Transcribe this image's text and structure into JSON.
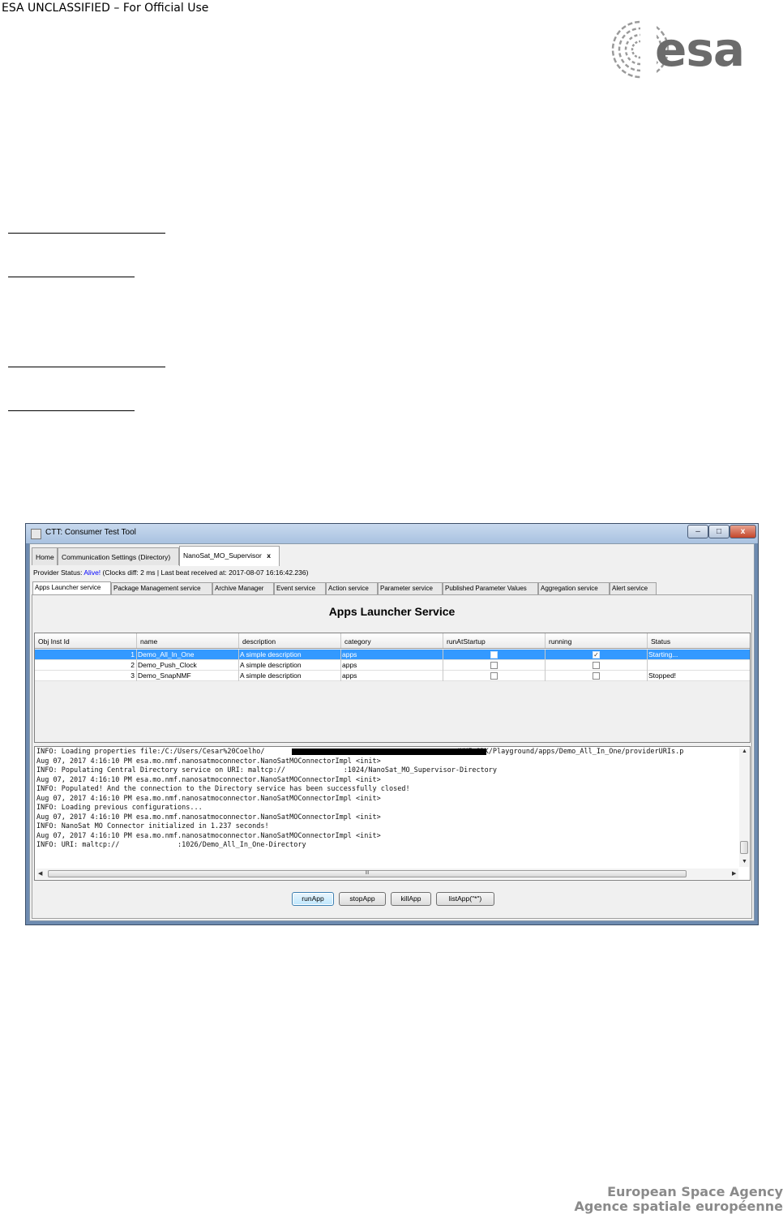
{
  "document": {
    "classification": "ESA UNCLASSIFIED – For Official Use",
    "logo_text": "esa",
    "footer_line1": "European Space Agency",
    "footer_line2": "Agence spatiale européenne"
  },
  "window": {
    "title": "CTT: Consumer Test Tool",
    "controls": {
      "minimize": "–",
      "maximize": "□",
      "close": "x"
    }
  },
  "top_tabs": [
    {
      "label": "Home"
    },
    {
      "label": "Communication Settings (Directory)"
    },
    {
      "label": "NanoSat_MO_Supervisor",
      "close": "x"
    }
  ],
  "provider_status": {
    "prefix": "Provider Status: ",
    "alive": "Alive!",
    "rest": " (Clocks diff: 2 ms | Last beat received at: 2017-08-07 16:16:42.236)"
  },
  "service_tabs": [
    {
      "label": "Apps Launcher service"
    },
    {
      "label": "Package Management service"
    },
    {
      "label": "Archive Manager"
    },
    {
      "label": "Event service"
    },
    {
      "label": "Action service"
    },
    {
      "label": "Parameter service"
    },
    {
      "label": "Published Parameter Values"
    },
    {
      "label": "Aggregation service"
    },
    {
      "label": "Alert service"
    }
  ],
  "panel": {
    "title": "Apps Launcher Service",
    "columns": [
      "Obj Inst Id",
      "name",
      "description",
      "category",
      "runAtStartup",
      "running",
      "Status"
    ],
    "rows": [
      {
        "id": "1",
        "name": "Demo_All_In_One",
        "description": "A simple description",
        "category": "apps",
        "runAtStartup": "",
        "running": "✓",
        "status": "Starting..."
      },
      {
        "id": "2",
        "name": "Demo_Push_Clock",
        "description": "A simple description",
        "category": "apps",
        "runAtStartup": "",
        "running": "",
        "status": ""
      },
      {
        "id": "3",
        "name": "Demo_SnapNMF",
        "description": "A simple description",
        "category": "apps",
        "runAtStartup": "",
        "running": "",
        "status": "Stopped!"
      }
    ],
    "log_lines": [
      "INFO: Loading properties file:/C:/Users/Cesar%20Coelho/                                              /NMF_SDK/Playground/apps/Demo_All_In_One/providerURIs.p",
      "Aug 07, 2017 4:16:10 PM esa.mo.nmf.nanosatmoconnector.NanoSatMOConnectorImpl <init>",
      "INFO: Populating Central Directory service on URI: maltcp://              :1024/NanoSat_MO_Supervisor-Directory",
      "Aug 07, 2017 4:16:10 PM esa.mo.nmf.nanosatmoconnector.NanoSatMOConnectorImpl <init>",
      "INFO: Populated! And the connection to the Directory service has been successfully closed!",
      "Aug 07, 2017 4:16:10 PM esa.mo.nmf.nanosatmoconnector.NanoSatMOConnectorImpl <init>",
      "INFO: Loading previous configurations...",
      "Aug 07, 2017 4:16:10 PM esa.mo.nmf.nanosatmoconnector.NanoSatMOConnectorImpl <init>",
      "INFO: NanoSat MO Connector initialized in 1.237 seconds!",
      "Aug 07, 2017 4:16:10 PM esa.mo.nmf.nanosatmoconnector.NanoSatMOConnectorImpl <init>",
      "INFO: URI: maltcp://              :1026/Demo_All_In_One-Directory"
    ],
    "scroll_grip": "III",
    "buttons": [
      {
        "label": "runApp"
      },
      {
        "label": "stopApp"
      },
      {
        "label": "killApp"
      },
      {
        "label": "listApp(\"*\")"
      }
    ]
  }
}
